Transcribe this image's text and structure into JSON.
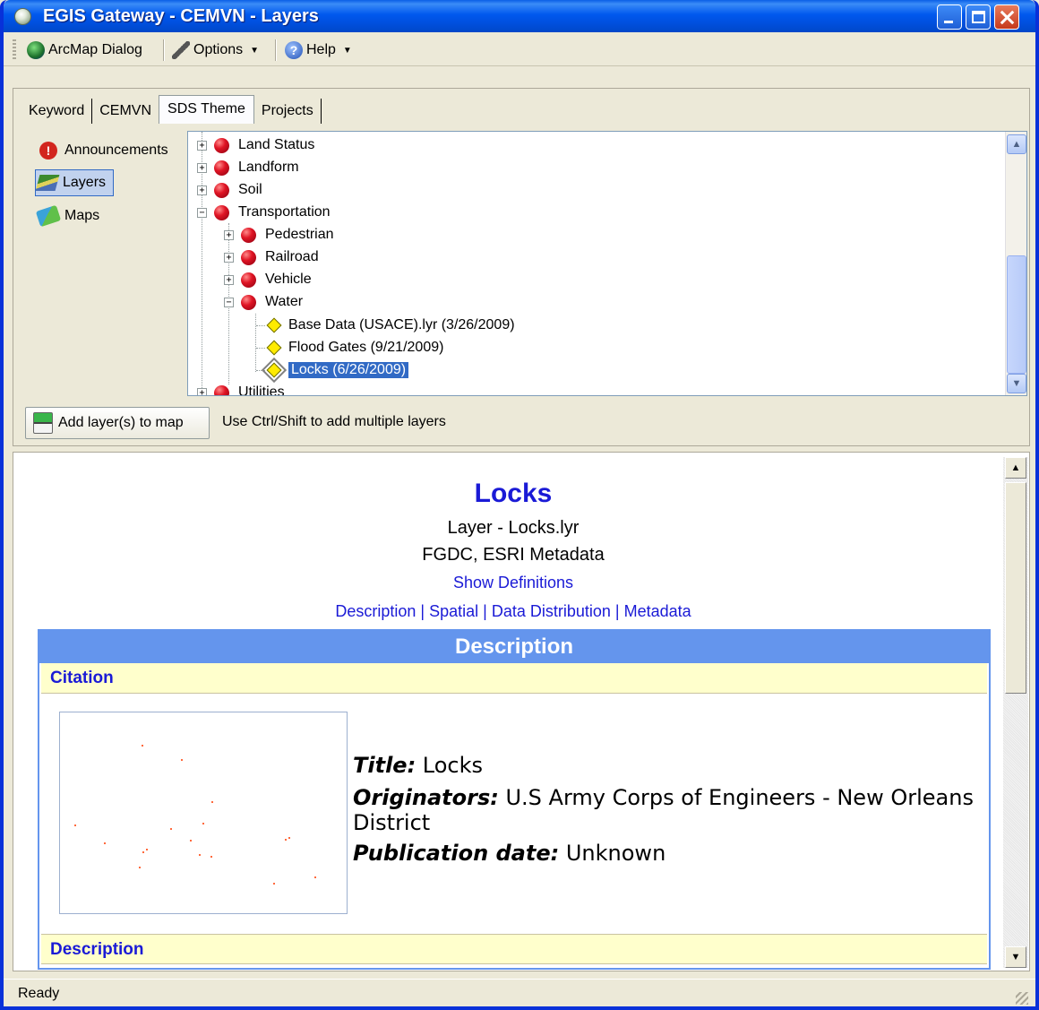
{
  "window": {
    "title": "EGIS Gateway - CEMVN - Layers"
  },
  "menubar": {
    "items": [
      {
        "label": "ArcMap Dialog",
        "icon": "globe-icon"
      },
      {
        "label": "Options",
        "icon": "wrench-icon"
      },
      {
        "label": "Help",
        "icon": "help-icon"
      }
    ]
  },
  "tabs": [
    "Keyword",
    "CEMVN",
    "SDS Theme",
    "Projects"
  ],
  "active_tab": "SDS Theme",
  "sidebar": {
    "items": [
      {
        "label": "Announcements",
        "icon": "alert-icon"
      },
      {
        "label": "Layers",
        "icon": "layers-icon"
      },
      {
        "label": "Maps",
        "icon": "maps-icon"
      }
    ],
    "selected": "Layers"
  },
  "tree": {
    "rows": [
      {
        "label": "Land Status",
        "level": 0,
        "type": "folder",
        "expander": "+"
      },
      {
        "label": "Landform",
        "level": 0,
        "type": "folder",
        "expander": "+"
      },
      {
        "label": "Soil",
        "level": 0,
        "type": "folder",
        "expander": "+"
      },
      {
        "label": "Transportation",
        "level": 0,
        "type": "folder",
        "expander": "−"
      },
      {
        "label": "Pedestrian",
        "level": 1,
        "type": "folder",
        "expander": "+"
      },
      {
        "label": "Railroad",
        "level": 1,
        "type": "folder",
        "expander": "+"
      },
      {
        "label": "Vehicle",
        "level": 1,
        "type": "folder",
        "expander": "+"
      },
      {
        "label": "Water",
        "level": 1,
        "type": "folder",
        "expander": "−"
      },
      {
        "label": "Base Data (USACE).lyr (3/26/2009)",
        "level": 2,
        "type": "layer"
      },
      {
        "label": "Flood Gates (9/21/2009)",
        "level": 2,
        "type": "layer"
      },
      {
        "label": "Locks (6/26/2009)",
        "level": 2,
        "type": "layer",
        "selected": true
      },
      {
        "label": "Utilities",
        "level": 0,
        "type": "folder",
        "expander": "+"
      }
    ]
  },
  "actions": {
    "add_label": "Add layer(s) to map",
    "hint": "Use Ctrl/Shift to add multiple layers"
  },
  "detail": {
    "heading": "Locks",
    "subtitle": "Layer - Locks.lyr",
    "formats": "FGDC, ESRI Metadata",
    "show_definitions": "Show Definitions",
    "nav": [
      "Description",
      "Spatial",
      "Data Distribution",
      "Metadata"
    ],
    "nav_sep": " | ",
    "section_title": "Description",
    "citation_label": "Citation",
    "title_label": "Title:",
    "title_value": " Locks",
    "originators_label": "Originators:",
    "originators_value": " U.S Army Corps of Engineers - New Orleans District",
    "pubdate_label": "Publication date:",
    "pubdate_value": " Unknown",
    "description_label": "Description",
    "point_color": "#ff6a3d",
    "accent_color": "#6495ed",
    "link_color": "#1a1ad6"
  },
  "status": {
    "text": "Ready"
  }
}
